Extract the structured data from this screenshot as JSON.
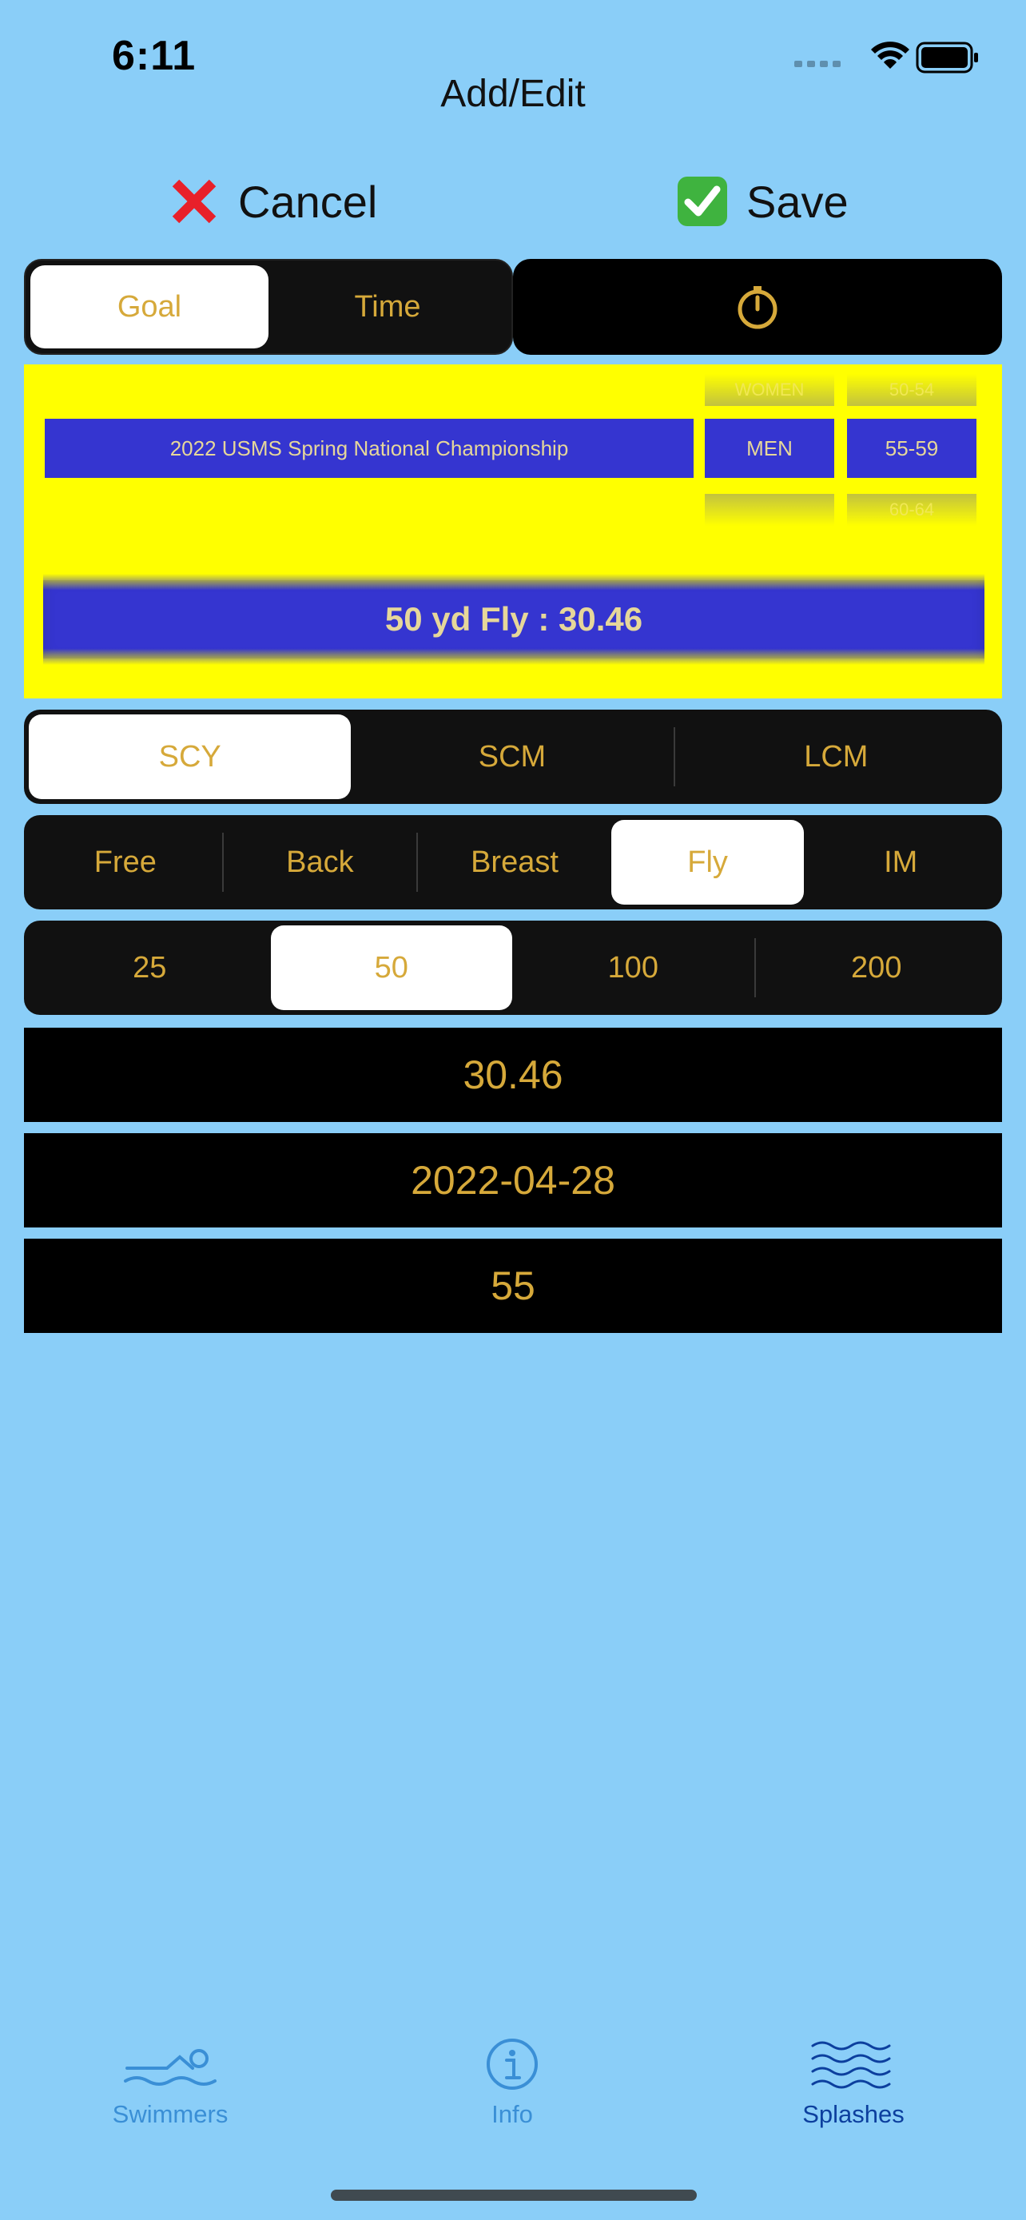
{
  "status_bar": {
    "time": "6:11"
  },
  "nav": {
    "title": "Add/Edit",
    "cancel_label": "Cancel",
    "save_label": "Save"
  },
  "mode_toggle": {
    "options": [
      "Goal",
      "Time"
    ],
    "selected": "Goal"
  },
  "picker": {
    "meet": "2022 USMS Spring National Championship",
    "gender": {
      "above": "WOMEN",
      "selected": "MEN",
      "below": ""
    },
    "age_group": {
      "above": "50-54",
      "selected": "55-59",
      "below": "60-64"
    },
    "event_summary": "50 yd Fly : 30.46"
  },
  "course": {
    "options": [
      "SCY",
      "SCM",
      "LCM"
    ],
    "selected": "SCY"
  },
  "stroke": {
    "options": [
      "Free",
      "Back",
      "Breast",
      "Fly",
      "IM"
    ],
    "selected": "Fly"
  },
  "distance": {
    "options": [
      "25",
      "50",
      "100",
      "200"
    ],
    "selected": "50"
  },
  "fields": {
    "time": "30.46",
    "date": "2022-04-28",
    "age": "55"
  },
  "tabs": [
    {
      "label": "Swimmers",
      "icon": "swimmer-icon",
      "active": false
    },
    {
      "label": "Info",
      "icon": "info-icon",
      "active": false
    },
    {
      "label": "Splashes",
      "icon": "waves-icon",
      "active": true
    }
  ],
  "colors": {
    "background": "#8ACEF8",
    "accent_gold": "#D6A93A",
    "picker_yellow": "#FFFF00",
    "picker_blue": "#3535D0"
  }
}
